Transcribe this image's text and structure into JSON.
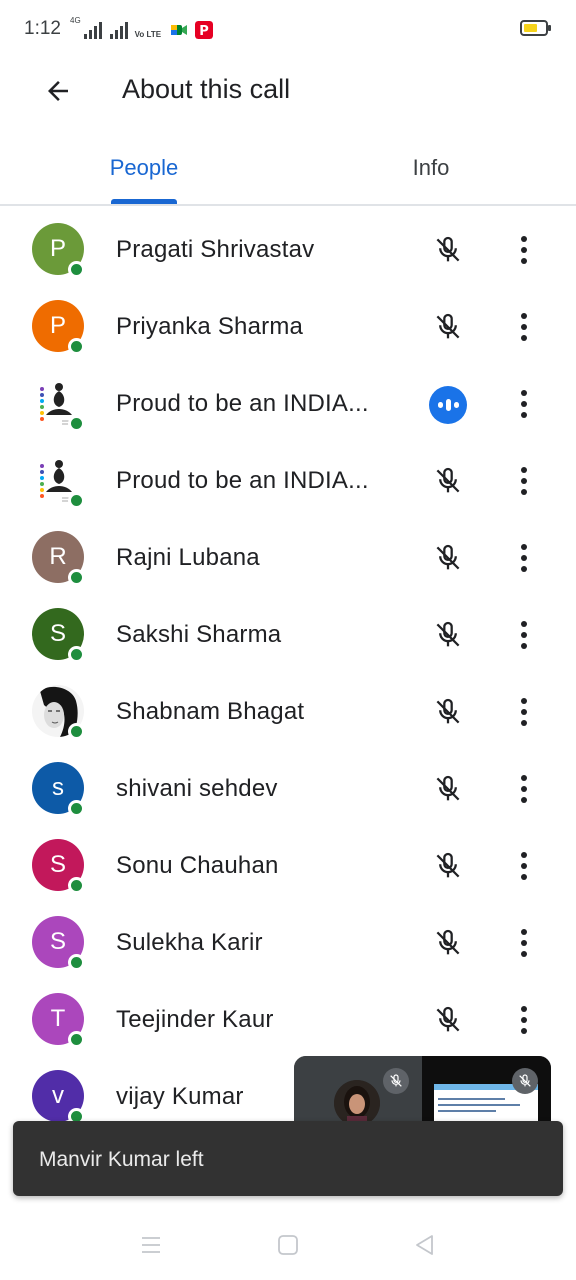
{
  "status_bar": {
    "time": "1:12",
    "network_label": "4G",
    "volte_label": "Vo LTE",
    "battery_level": 0.65
  },
  "header": {
    "title": "About this call",
    "back_icon": "arrow-back-icon"
  },
  "tabs": [
    {
      "label": "People",
      "selected": true
    },
    {
      "label": "Info",
      "selected": false
    }
  ],
  "people": [
    {
      "name": "Pragati Shrivastav",
      "initial": "P",
      "avatar_color": "#6b9a39",
      "avatar_type": "letter",
      "status": "muted"
    },
    {
      "name": "Priyanka Sharma",
      "initial": "P",
      "avatar_color": "#ef6c00",
      "avatar_type": "letter",
      "status": "muted"
    },
    {
      "name": "Proud to be an INDIA...",
      "initial": "",
      "avatar_color": "#ffffff",
      "avatar_type": "chakra-image",
      "status": "speaking"
    },
    {
      "name": "Proud to be an INDIA...",
      "initial": "",
      "avatar_color": "#ffffff",
      "avatar_type": "chakra-image",
      "status": "muted"
    },
    {
      "name": "Rajni Lubana",
      "initial": "R",
      "avatar_color": "#8d6e63",
      "avatar_type": "letter",
      "status": "muted"
    },
    {
      "name": "Sakshi Sharma",
      "initial": "S",
      "avatar_color": "#33691e",
      "avatar_type": "letter",
      "status": "muted"
    },
    {
      "name": "Shabnam Bhagat",
      "initial": "",
      "avatar_color": "#ffffff",
      "avatar_type": "portrait-image",
      "status": "muted"
    },
    {
      "name": "shivani sehdev",
      "initial": "s",
      "avatar_color": "#0d5aa7",
      "avatar_type": "letter",
      "status": "muted"
    },
    {
      "name": "Sonu Chauhan",
      "initial": "S",
      "avatar_color": "#c2185b",
      "avatar_type": "letter",
      "status": "muted"
    },
    {
      "name": "Sulekha Karir",
      "initial": "S",
      "avatar_color": "#ab47bc",
      "avatar_type": "letter",
      "status": "muted"
    },
    {
      "name": "Teejinder Kaur",
      "initial": "T",
      "avatar_color": "#ab47bc",
      "avatar_type": "letter",
      "status": "muted"
    },
    {
      "name": "vijay Kumar",
      "initial": "v",
      "avatar_color": "#512da8",
      "avatar_type": "letter",
      "status": "muted"
    }
  ],
  "snackbar": {
    "message": "Manvir Kumar left"
  },
  "colors": {
    "accent": "#1967d2",
    "presence": "#1e8e3e",
    "speaking": "#1a73e8",
    "snackbar_bg": "#323232"
  },
  "icons": {
    "mic_off": "mic-off-icon",
    "more": "more-vert-icon",
    "speaking": "speaking-indicator-icon",
    "nav_recents": "recents-icon",
    "nav_home": "home-icon",
    "nav_back": "nav-back-icon"
  }
}
